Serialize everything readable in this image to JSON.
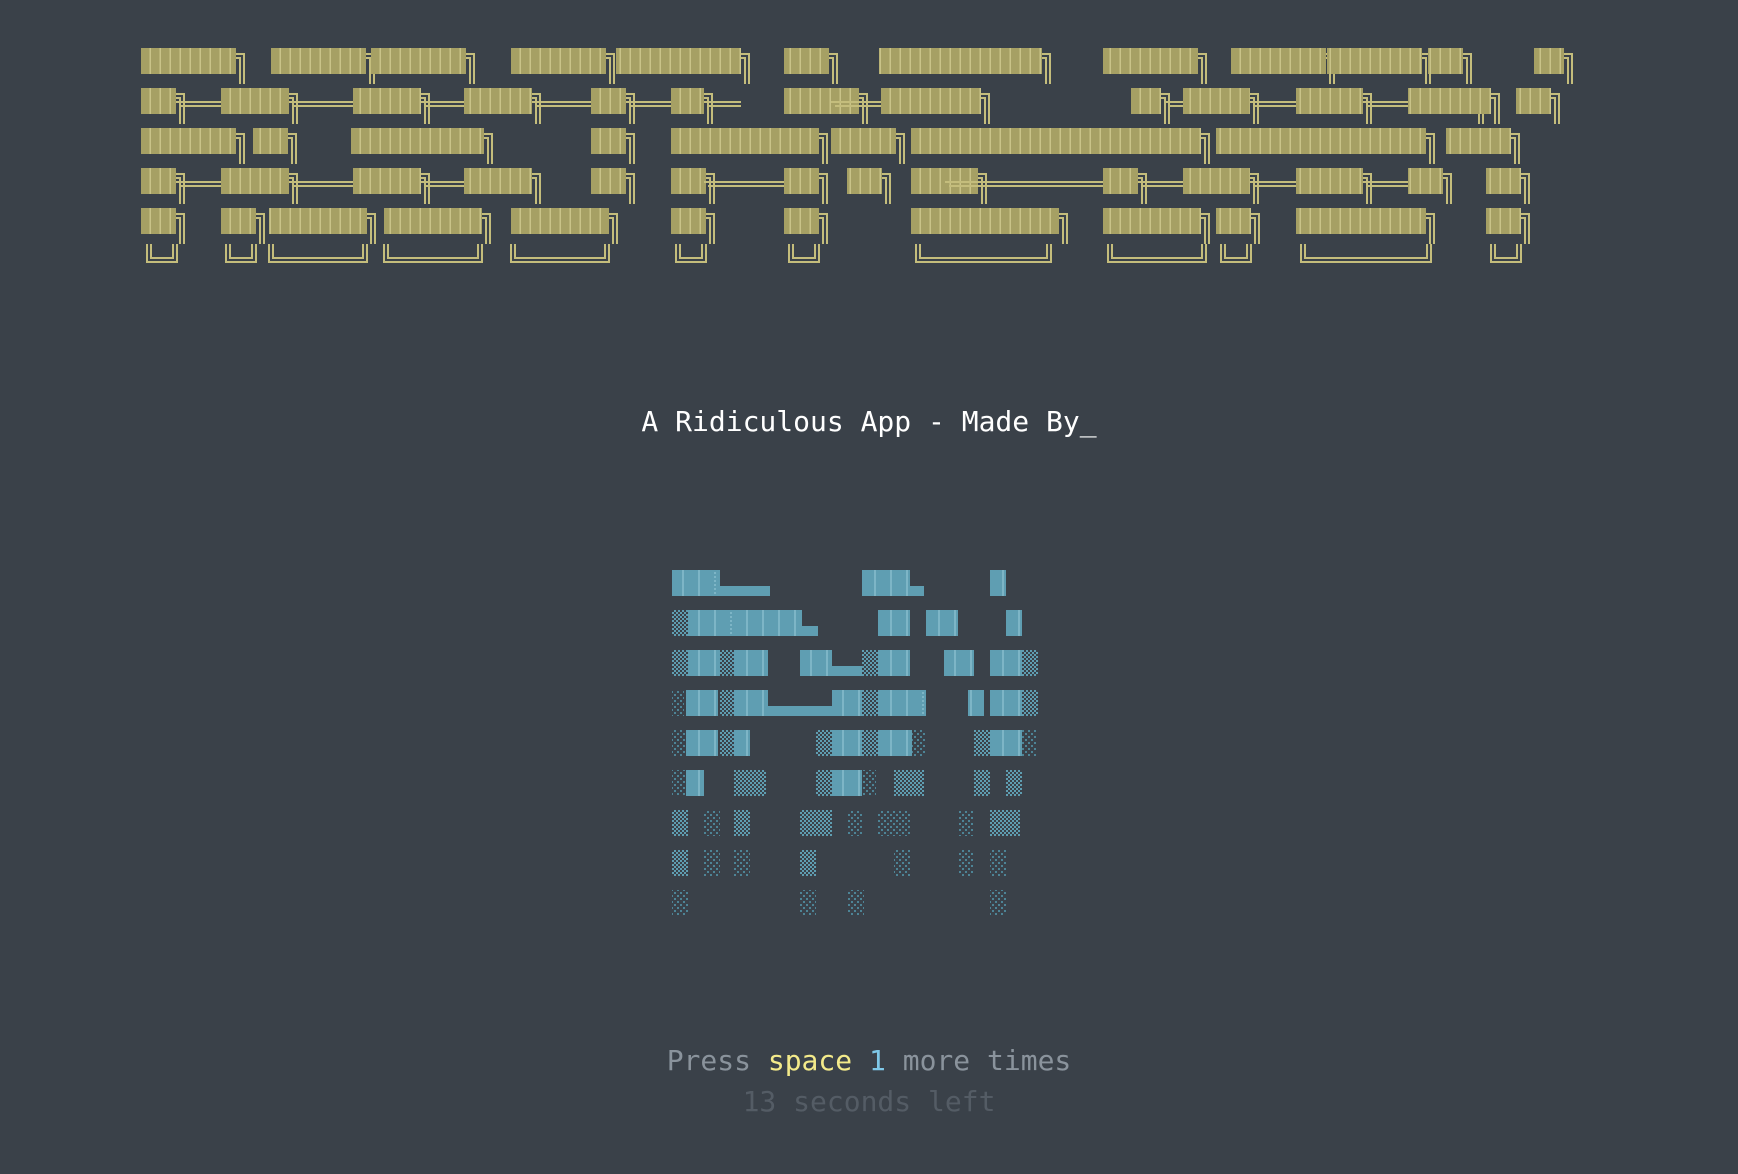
{
  "colors": {
    "background": "#3a4149",
    "banner_block": "#a6a064",
    "banner_outline": "#c4bd7c",
    "logo_block": "#5f9eb2",
    "logo_shade": "#4d8496",
    "subtitle_text": "#ffffff",
    "prompt_text": "#8a939c",
    "prompt_key": "#f3ea8a",
    "prompt_count": "#7fc8e8",
    "timer_text": "#545c65"
  },
  "banner": {
    "icon": "ascii-art-banner-icon"
  },
  "subtitle": {
    "text": "A Ridiculous App - Made By",
    "cursor": "_"
  },
  "logo": {
    "icon": "ascii-art-logo-icon"
  },
  "prompt": {
    "prefix": "Press ",
    "key": "space",
    "count": "1",
    "suffix": " more times"
  },
  "timer": {
    "text": "13 seconds left"
  }
}
